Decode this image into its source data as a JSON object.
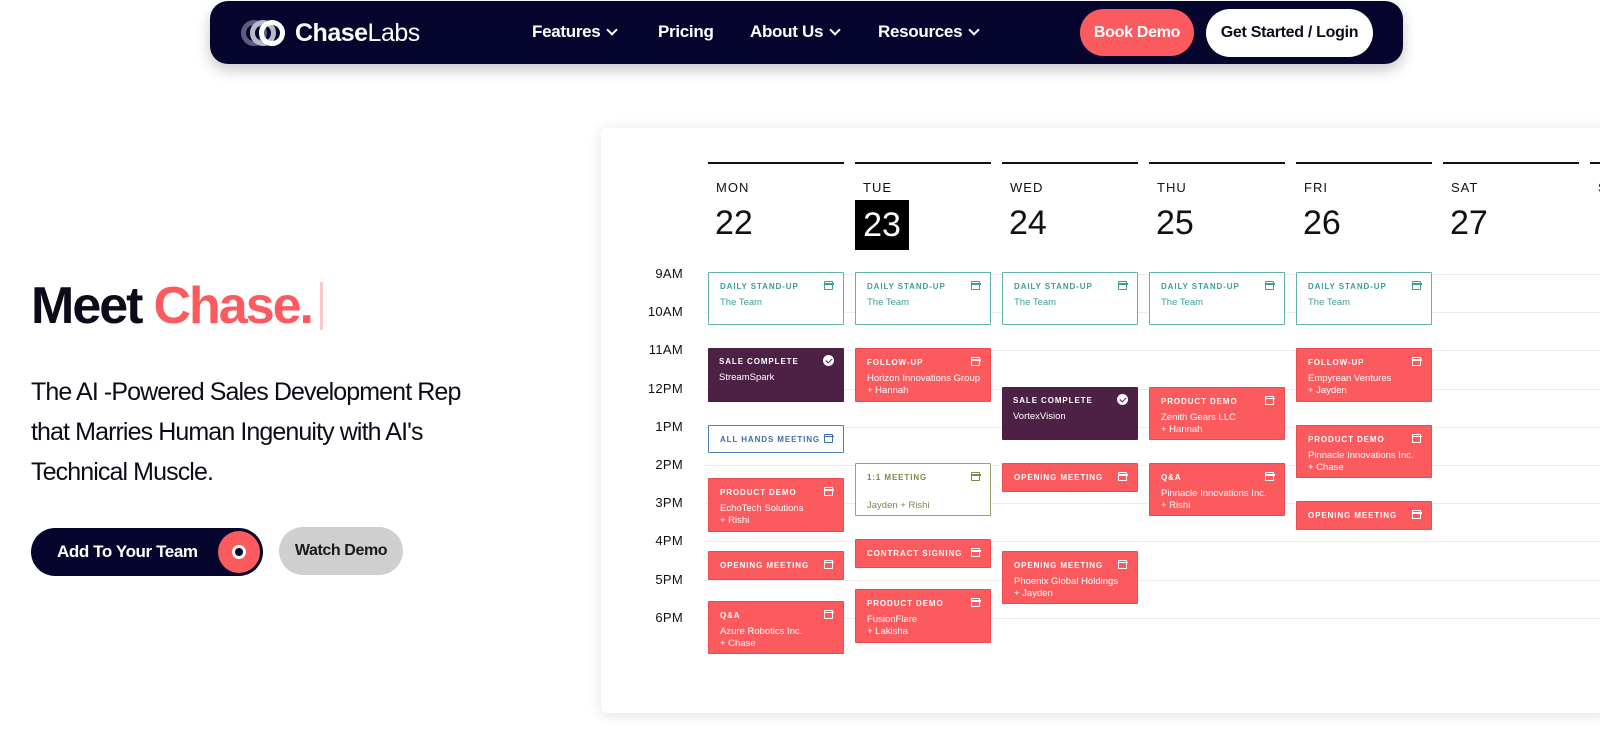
{
  "nav": {
    "logo_bold": "Chase",
    "logo_light": "Labs",
    "items": [
      {
        "label": "Features",
        "dropdown": true
      },
      {
        "label": "Pricing",
        "dropdown": false
      },
      {
        "label": "About Us",
        "dropdown": true
      },
      {
        "label": "Resources",
        "dropdown": true
      }
    ],
    "book_demo": "Book Demo",
    "login": "Get Started / Login"
  },
  "hero": {
    "title_prefix": "Meet",
    "title_accent": "Chase.",
    "subtitle": "The AI -Powered Sales Development Rep that Marries Human Ingenuity with AI's Technical Muscle.",
    "cta_primary": "Add To Your Team",
    "cta_secondary": "Watch Demo"
  },
  "calendar": {
    "days": [
      {
        "name": "MON",
        "num": "22",
        "today": false
      },
      {
        "name": "TUE",
        "num": "23",
        "today": true
      },
      {
        "name": "WED",
        "num": "24",
        "today": false
      },
      {
        "name": "THU",
        "num": "25",
        "today": false
      },
      {
        "name": "FRI",
        "num": "26",
        "today": false
      },
      {
        "name": "SAT",
        "num": "27",
        "today": false
      },
      {
        "name": "S",
        "num": "",
        "today": false
      }
    ],
    "times": [
      "9AM",
      "10AM",
      "11AM",
      "12PM",
      "1PM",
      "2PM",
      "3PM",
      "4PM",
      "5PM",
      "6PM"
    ],
    "colors": {
      "coral": "#fb5a5e",
      "purple": "#4d2146",
      "teal": "#3d9e97",
      "navy": "#05052e"
    },
    "events": [
      {
        "day": 0,
        "start": 9,
        "dur": 1.4,
        "style": "teal",
        "icon": "calendar-icon",
        "title": "DAILY STAND-UP",
        "lines": [
          "The Team"
        ]
      },
      {
        "day": 1,
        "start": 9,
        "dur": 1.4,
        "style": "teal",
        "icon": "calendar-icon",
        "title": "DAILY STAND-UP",
        "lines": [
          "The Team"
        ]
      },
      {
        "day": 2,
        "start": 9,
        "dur": 1.4,
        "style": "teal",
        "icon": "calendar-icon",
        "title": "DAILY STAND-UP",
        "lines": [
          "The Team"
        ]
      },
      {
        "day": 3,
        "start": 9,
        "dur": 1.4,
        "style": "teal",
        "icon": "calendar-icon",
        "title": "DAILY STAND-UP",
        "lines": [
          "The Team"
        ]
      },
      {
        "day": 4,
        "start": 9,
        "dur": 1.4,
        "style": "teal",
        "icon": "calendar-icon",
        "title": "DAILY STAND-UP",
        "lines": [
          "The Team"
        ]
      },
      {
        "day": 0,
        "start": 11,
        "dur": 1.4,
        "style": "purple",
        "icon": "check-circle-icon",
        "title": "SALE COMPLETE",
        "lines": [
          "StreamSpark"
        ]
      },
      {
        "day": 0,
        "start": 13,
        "dur": 0.75,
        "style": "blue",
        "icon": "calendar-icon",
        "title": "ALL HANDS MEETING",
        "lines": []
      },
      {
        "day": 0,
        "start": 14.4,
        "dur": 1.4,
        "style": "coral",
        "icon": "calendar-icon",
        "title": "PRODUCT DEMO",
        "lines": [
          "EchoTech Solutions",
          "+ Rishi"
        ]
      },
      {
        "day": 0,
        "start": 16.3,
        "dur": 0.75,
        "style": "coral",
        "icon": "calendar-icon",
        "title": "OPENING MEETING",
        "lines": []
      },
      {
        "day": 0,
        "start": 17.6,
        "dur": 1.4,
        "style": "coral",
        "icon": "calendar-icon",
        "title": "Q&A",
        "lines": [
          "Azure Robotics Inc.",
          "+ Chase"
        ]
      },
      {
        "day": 1,
        "start": 11,
        "dur": 1.4,
        "style": "coral",
        "icon": "calendar-icon",
        "title": "FOLLOW-UP",
        "lines": [
          "Horizon Innovations Group",
          "+ Hannah"
        ]
      },
      {
        "day": 1,
        "start": 14,
        "dur": 1.4,
        "style": "olive",
        "icon": "calendar-icon",
        "title": "1:1 MEETING",
        "lines": [
          "",
          "Jayden + Rishi"
        ]
      },
      {
        "day": 1,
        "start": 16,
        "dur": 0.75,
        "style": "coral",
        "icon": "calendar-icon",
        "title": "CONTRACT SIGNING",
        "lines": []
      },
      {
        "day": 1,
        "start": 17.3,
        "dur": 1.4,
        "style": "coral",
        "icon": "calendar-icon",
        "title": "PRODUCT DEMO",
        "lines": [
          "FusionFlare",
          "+ Lakisha"
        ]
      },
      {
        "day": 2,
        "start": 12,
        "dur": 1.4,
        "style": "purple",
        "icon": "check-circle-icon",
        "title": "SALE COMPLETE",
        "lines": [
          "VortexVision"
        ]
      },
      {
        "day": 2,
        "start": 14,
        "dur": 0.75,
        "style": "coral",
        "icon": "calendar-icon",
        "title": "OPENING MEETING",
        "lines": []
      },
      {
        "day": 2,
        "start": 16.3,
        "dur": 1.4,
        "style": "coral",
        "icon": "calendar-icon",
        "title": "OPENING MEETING",
        "lines": [
          "Phoenix Global Holdings",
          "+ Jayden"
        ]
      },
      {
        "day": 3,
        "start": 12,
        "dur": 1.4,
        "style": "coral",
        "icon": "calendar-icon",
        "title": "PRODUCT DEMO",
        "lines": [
          "Zenith Gears LLC",
          "+ Hannah"
        ]
      },
      {
        "day": 3,
        "start": 14,
        "dur": 1.4,
        "style": "coral",
        "icon": "calendar-icon",
        "title": "Q&A",
        "lines": [
          "Pinnacle Innovations Inc.",
          "+ Rishi"
        ]
      },
      {
        "day": 4,
        "start": 11,
        "dur": 1.4,
        "style": "coral",
        "icon": "calendar-icon",
        "title": "FOLLOW-UP",
        "lines": [
          "Empyrean Ventures",
          "+ Jayden"
        ]
      },
      {
        "day": 4,
        "start": 13,
        "dur": 1.4,
        "style": "coral",
        "icon": "calendar-icon",
        "title": "PRODUCT DEMO",
        "lines": [
          "Pinnacle Innovations Inc.",
          "+ Chase"
        ]
      },
      {
        "day": 4,
        "start": 15,
        "dur": 0.75,
        "style": "coral",
        "icon": "calendar-icon",
        "title": "OPENING MEETING",
        "lines": []
      }
    ]
  }
}
